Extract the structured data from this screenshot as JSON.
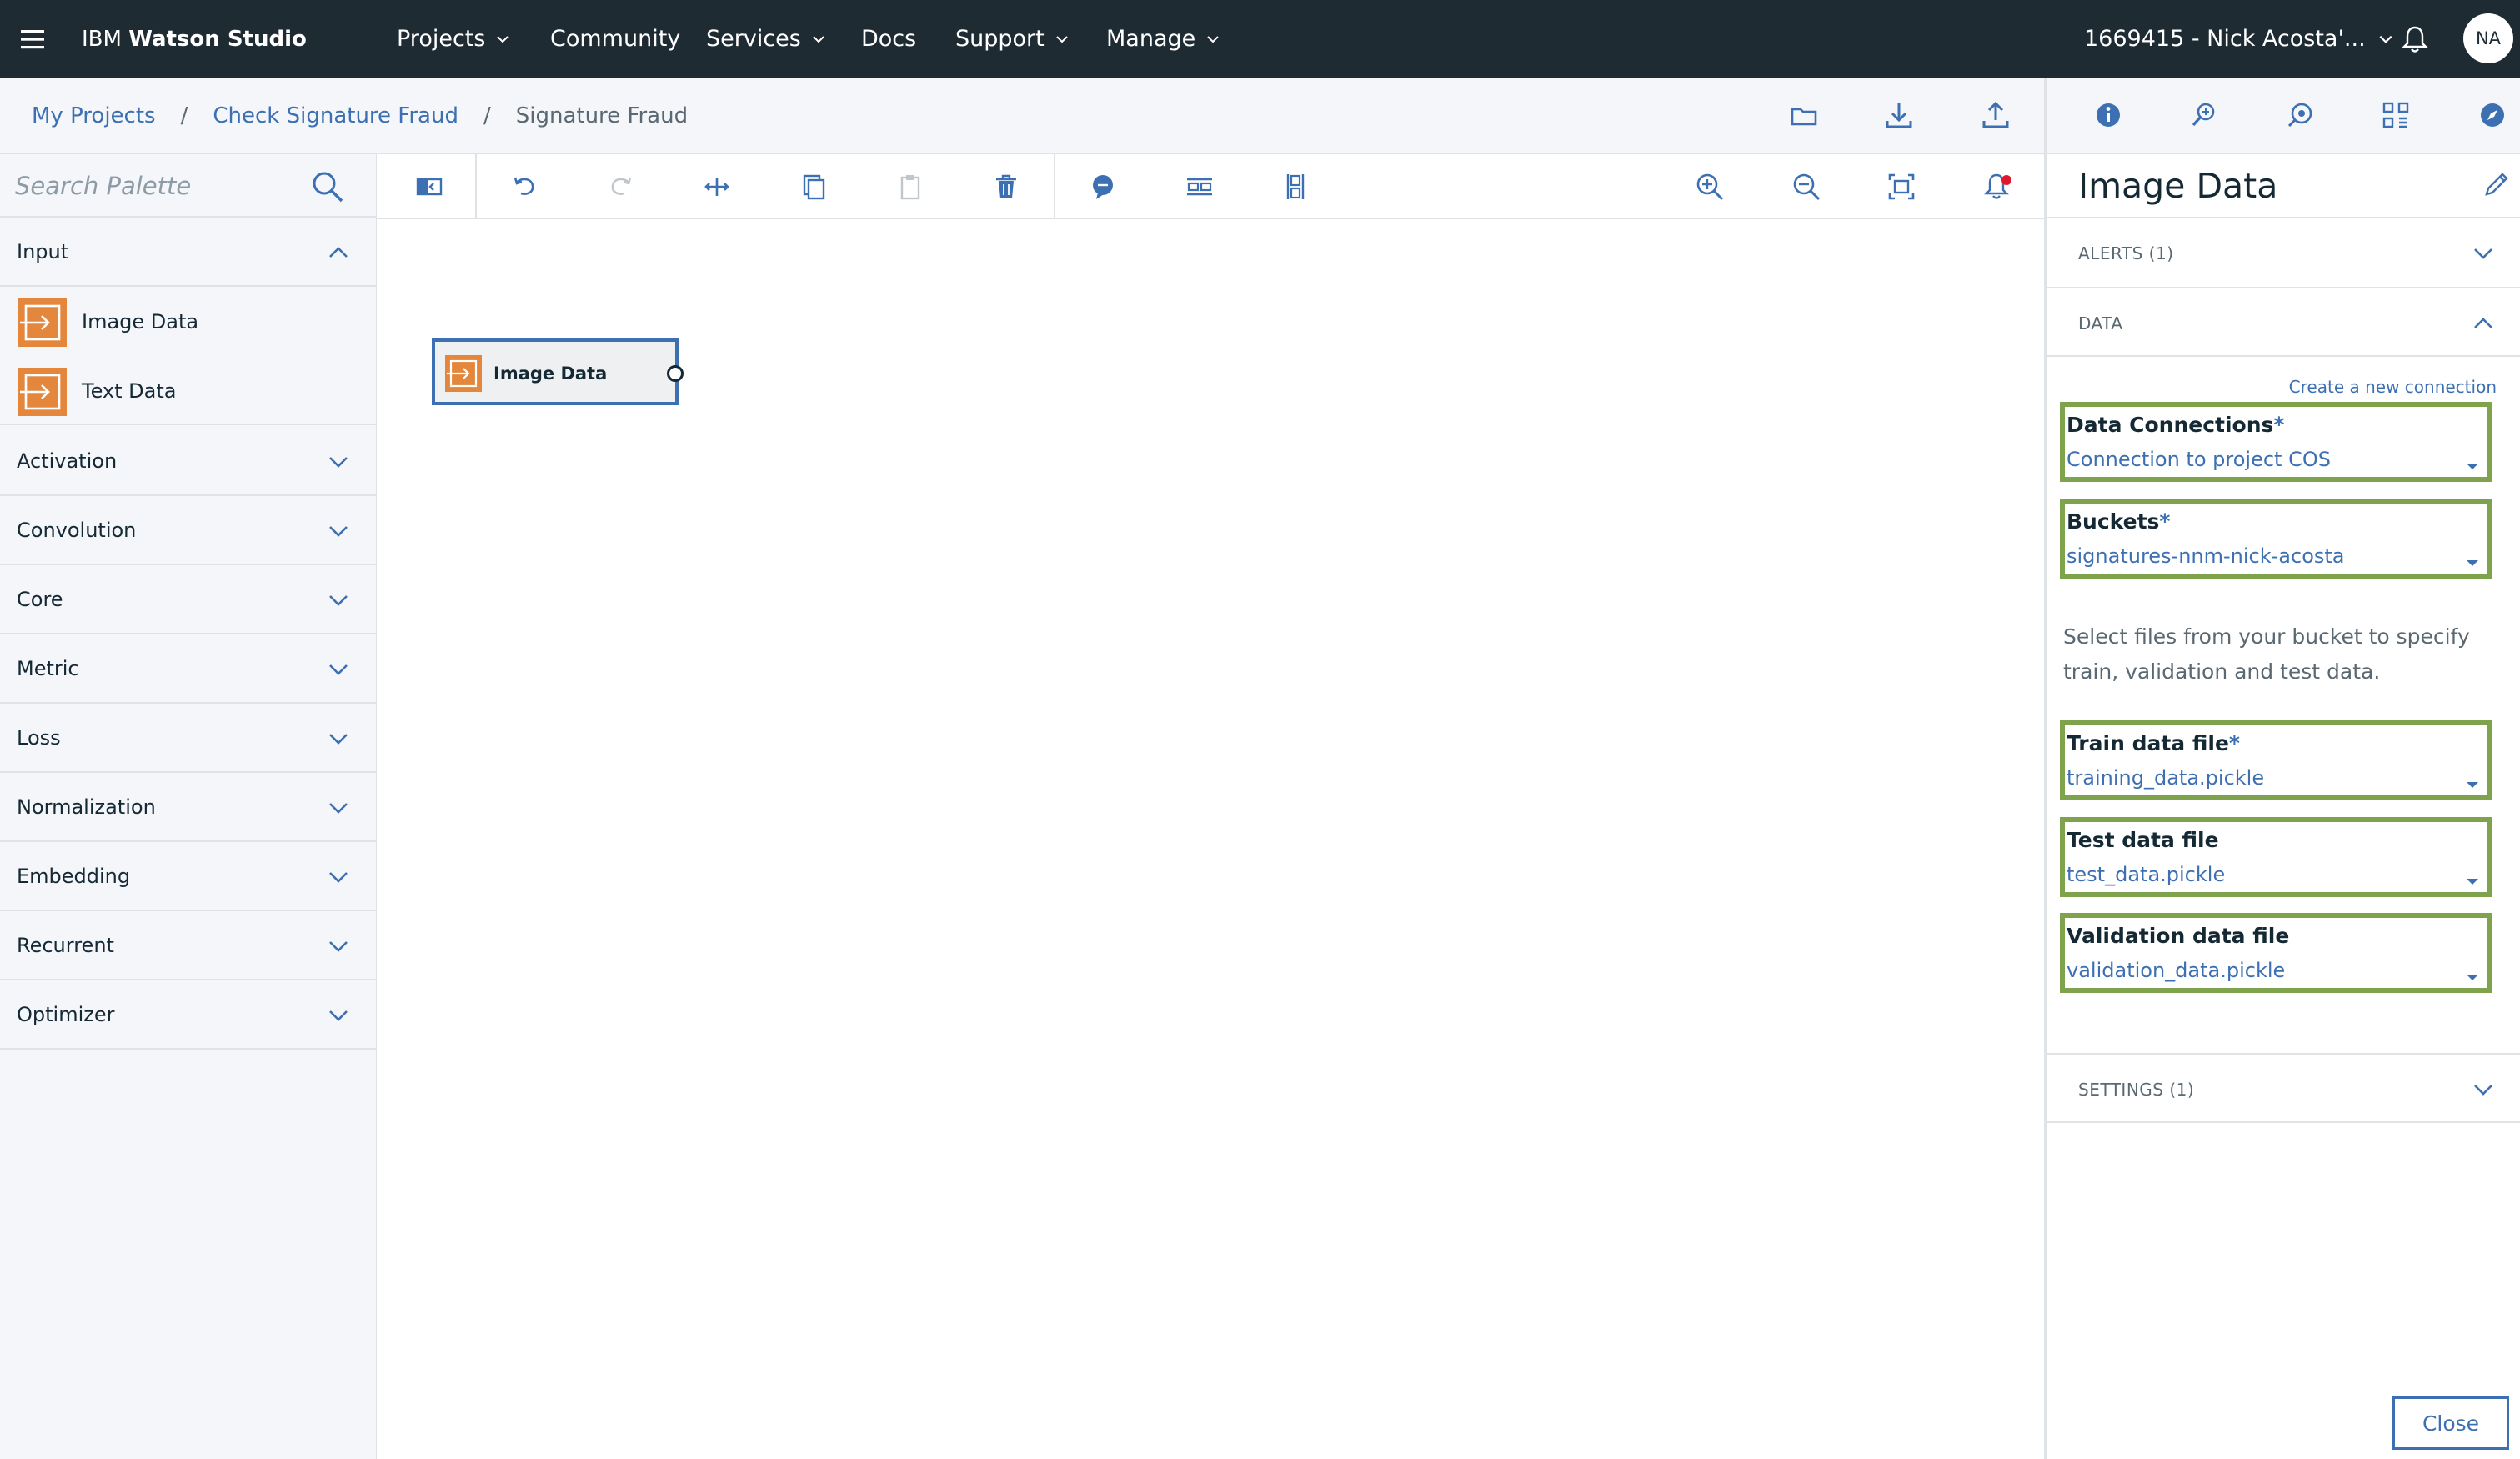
{
  "header": {
    "brand_prefix": "IBM ",
    "brand_name": "Watson Studio",
    "nav": [
      {
        "label": "Projects",
        "has_menu": true
      },
      {
        "label": "Community",
        "has_menu": false
      },
      {
        "label": "Services",
        "has_menu": true
      },
      {
        "label": "Docs",
        "has_menu": false
      },
      {
        "label": "Support",
        "has_menu": true
      },
      {
        "label": "Manage",
        "has_menu": true
      }
    ],
    "account": "1669415 - Nick Acosta'...",
    "avatar_initials": "NA"
  },
  "breadcrumb": {
    "items": [
      "My Projects",
      "Check Signature Fraud"
    ],
    "current": "Signature Fraud",
    "separator": "/"
  },
  "palette": {
    "search_placeholder": "Search Palette",
    "input_category": "Input",
    "input_nodes": [
      "Image Data",
      "Text Data"
    ],
    "categories": [
      "Activation",
      "Convolution",
      "Core",
      "Metric",
      "Loss",
      "Normalization",
      "Embedding",
      "Recurrent",
      "Optimizer"
    ]
  },
  "canvas": {
    "node_label": "Image Data"
  },
  "panel": {
    "title": "Image Data",
    "alerts_label": "ALERTS (1)",
    "data_label": "DATA",
    "settings_label": "SETTINGS (1)",
    "create_connection": "Create a new connection",
    "data_connections": {
      "label": "Data Connections",
      "required": "*",
      "value": "Connection to project COS"
    },
    "buckets": {
      "label": "Buckets",
      "required": "*",
      "value": "signatures-nnm-nick-acosta"
    },
    "help_text": "Select files from your bucket to specify train, validation and test data.",
    "train_file": {
      "label": "Train data file",
      "required": "*",
      "value": "training_data.pickle"
    },
    "test_file": {
      "label": "Test data file",
      "value": "test_data.pickle"
    },
    "validation_file": {
      "label": "Validation data file",
      "value": "validation_data.pickle"
    },
    "close_label": "Close"
  },
  "colors": {
    "header_bg": "#1f2b33",
    "accent_blue": "#3d70b2",
    "node_orange": "#e4873d",
    "highlight_green": "#7ea34c",
    "panel_gray": "#f4f6fa"
  },
  "icons": {
    "toolbar": [
      "toggle-palette-icon",
      "undo-icon",
      "redo-icon",
      "cut-icon",
      "copy-icon",
      "paste-icon",
      "delete-icon",
      "comment-icon",
      "arrange-horizontal-icon",
      "arrange-vertical-icon",
      "zoom-in-icon",
      "zoom-out-icon",
      "fit-to-screen-icon",
      "notifications-icon"
    ],
    "breadcrumb_actions": [
      "folder-icon",
      "download-icon",
      "upload-icon"
    ],
    "panel_tabs": [
      "info-icon",
      "hyperparameters-icon",
      "deploy-icon",
      "flows-icon",
      "compass-icon"
    ]
  }
}
